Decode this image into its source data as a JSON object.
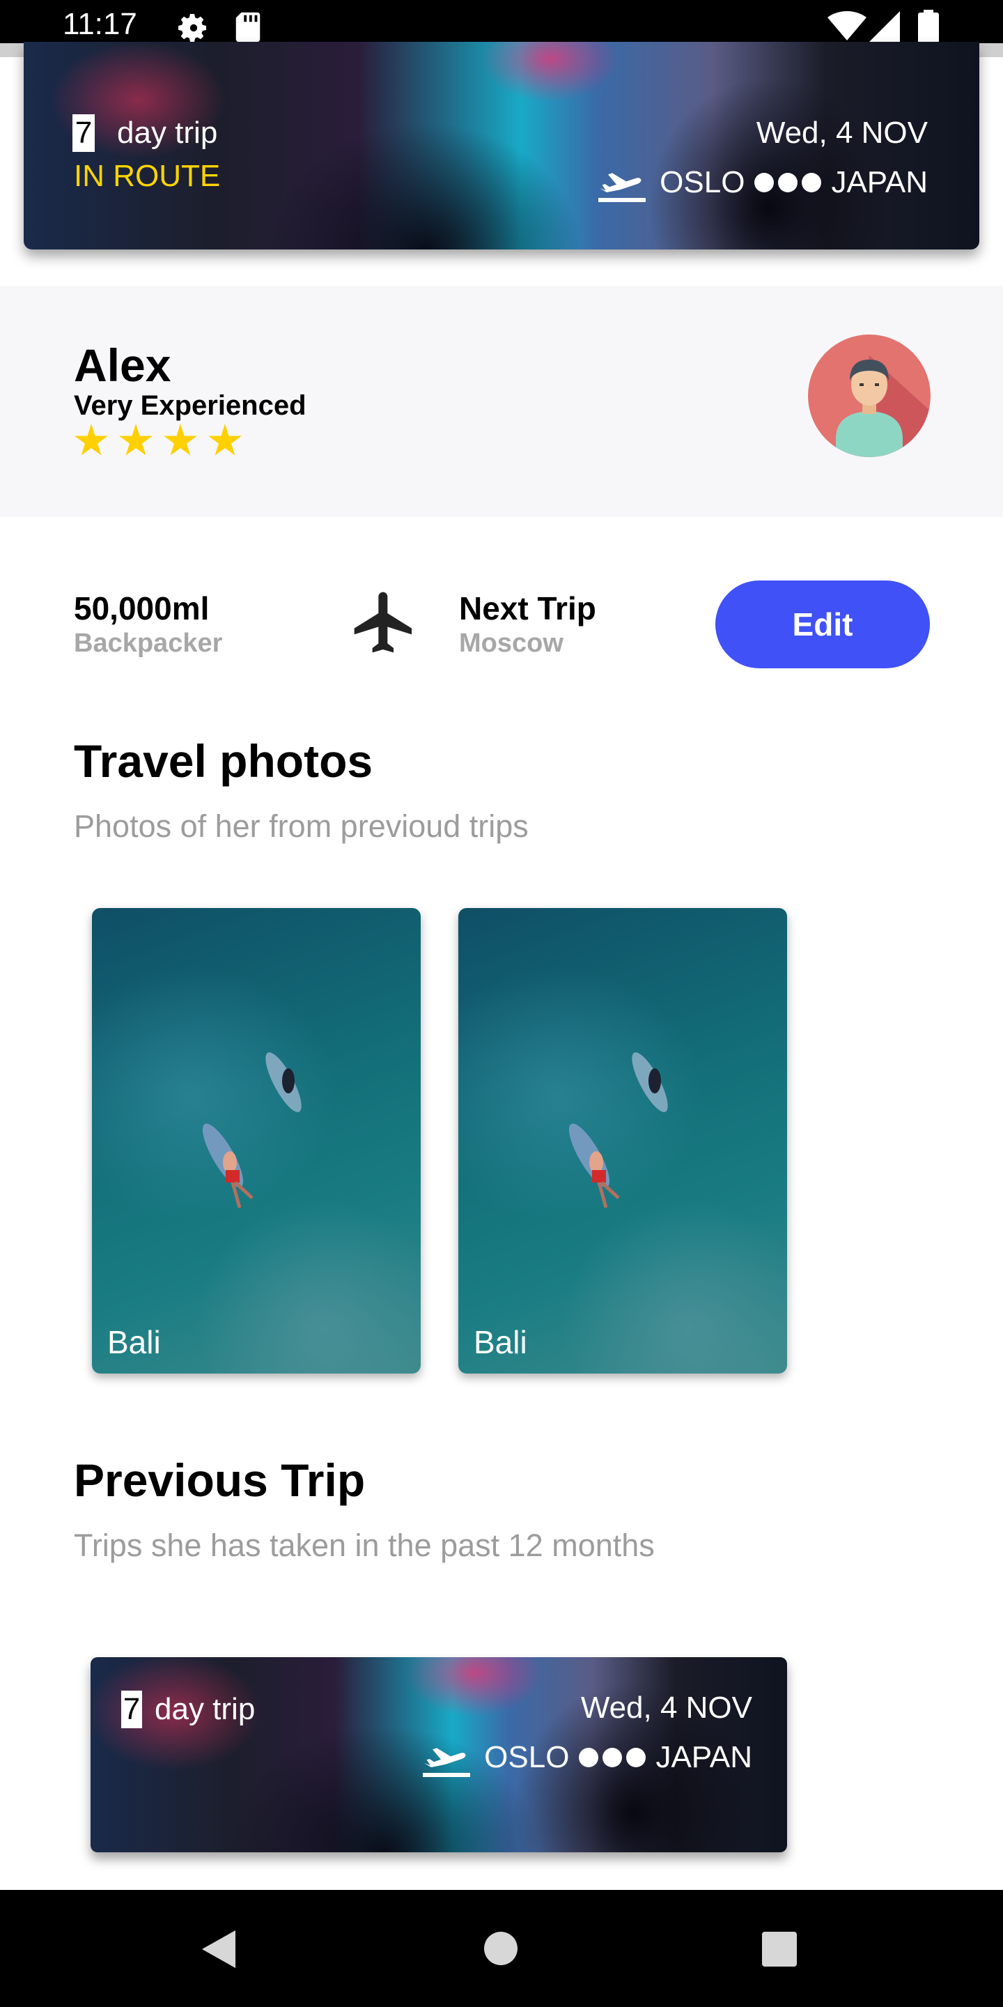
{
  "status_bar": {
    "time": "11:17",
    "icons": [
      "settings-icon",
      "sd-card-icon",
      "wifi-icon",
      "signal-icon",
      "battery-icon"
    ]
  },
  "current_trip": {
    "days": "7",
    "days_suffix": "day trip",
    "status": "IN ROUTE",
    "date": "Wed, 4 NOV",
    "from": "OSLO",
    "to": "JAPAN"
  },
  "profile": {
    "name": "Alex",
    "level": "Very Experienced",
    "rating": 4
  },
  "stats": {
    "distance_value": "50,000ml",
    "distance_label": "Backpacker",
    "next_trip_title": "Next Trip",
    "next_trip_city": "Moscow",
    "edit_label": "Edit"
  },
  "travel_photos": {
    "title": "Travel photos",
    "subtitle": "Photos of her from previoud trips",
    "items": [
      {
        "label": "Bali"
      },
      {
        "label": "Bali"
      }
    ]
  },
  "previous_trip": {
    "title": "Previous Trip",
    "subtitle": "Trips she has taken in the past 12 months",
    "card": {
      "days": "7",
      "days_suffix": "day trip",
      "date": "Wed, 4 NOV",
      "from": "OSLO",
      "to": "JAPAN"
    }
  },
  "colors": {
    "accent": "#3f51f7",
    "status_yellow": "#ffd400",
    "star": "#ffd000",
    "muted_text": "#9c9c9c"
  }
}
